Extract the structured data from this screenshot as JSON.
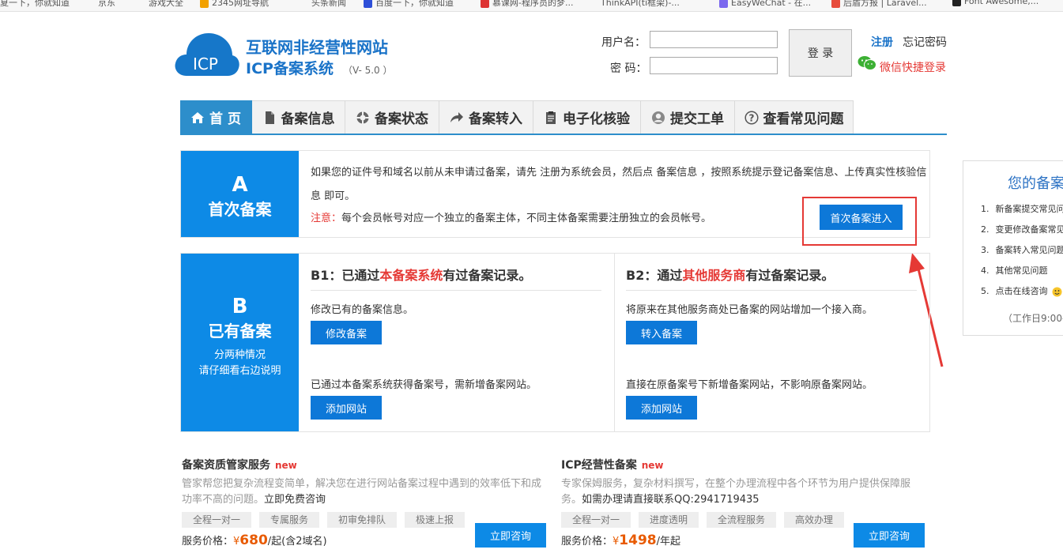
{
  "bookmarks": [
    "夏一下，你就知道",
    "京东",
    "游戏大全",
    "2345网址导航",
    "头条新闻",
    "百度一下，你就知道",
    "慕课网-程序员的梦...",
    "ThinkAPI(ti框架)-...",
    "EasyWeChat - 在...",
    "后盾方报 | Laravel...",
    "Font Awesome,..."
  ],
  "header": {
    "title_line1": "互联网非经营性网站",
    "title_line2": "ICP备案系统",
    "version": "（V- 5.0 ）",
    "logo_text": "ICP",
    "username_label": "用户名：",
    "password_label": "密  码：",
    "login_button": "登 录",
    "register_link": "注册",
    "forgot_link": "忘记密码",
    "wechat_login": "微信快捷登录"
  },
  "nav": [
    "首 页",
    "备案信息",
    "备案状态",
    "备案转入",
    "电子化核验",
    "提交工单",
    "查看常见问题"
  ],
  "sectionA": {
    "letter": "A",
    "title": "首次备案",
    "desc": "如果您的证件号和域名以前从未申请过备案，请先 注册为系统会员，然后点 备案信息 ，按照系统提示登记备案信息、上传真实性核验信息 即可。",
    "note_label": "注意：",
    "note_text": "每个会员帐号对应一个独立的备案主体，不同主体备案需要注册独立的会员帐号。",
    "button": "首次备案进入"
  },
  "sectionB": {
    "letter": "B",
    "title": "已有备案",
    "sub1": "分两种情况",
    "sub2": "请仔细看右边说明",
    "b1": {
      "head_pre": "B1：已通过",
      "head_red": "本备案系统",
      "head_post": "有过备案记录。",
      "text1": "修改已有的备案信息。",
      "btn1": "修改备案",
      "text2": "已通过本备案系统获得备案号，需新增备案网站。",
      "btn2": "添加网站"
    },
    "b2": {
      "head_pre": "B2：通过",
      "head_red": "其他服务商",
      "head_post": "有过备案记录。",
      "text1": "将原来在其他服务商处已备案的网站增加一个接入商。",
      "btn1": "转入备案",
      "text2": "直接在原备案号下新增备案网站，不影响原备案网站。",
      "btn2": "添加网站"
    }
  },
  "side": {
    "title": "您的备案",
    "items": [
      {
        "num": "1.",
        "text": "新备案提交常见问"
      },
      {
        "num": "2.",
        "text": "变更修改备案常见"
      },
      {
        "num": "3.",
        "text": "备案转入常见问题"
      },
      {
        "num": "4.",
        "text": "其他常见问题"
      },
      {
        "num": "5.",
        "text": "点击在线咨询"
      }
    ],
    "footer": "（工作日9:00-"
  },
  "services": [
    {
      "title": "备案资质管家服务",
      "new": "new",
      "desc_gray": "管家帮您把复杂流程变简单，解决您在进行网站备案过程中遇到的效率低下和成功率不高的问题。",
      "desc_dark": "立即免费咨询",
      "tags": [
        "全程一对一",
        "专属服务",
        "初审免排队",
        "极速上报"
      ],
      "price_label": "服务价格：",
      "price_yen": "¥",
      "price_amount": "680",
      "price_unit": "/起(含2域名)",
      "button": "立即咨询"
    },
    {
      "title": "ICP经营性备案",
      "new": "new",
      "desc_gray": "专家保姆服务，复杂材料撰写，在整个办理流程中各个环节为用户提供保障服务。",
      "desc_dark": "如需办理请直接联系QQ:2941719435",
      "tags": [
        "全程一对一",
        "进度透明",
        "全流程服务",
        "高效办理"
      ],
      "price_label": "服务价格：",
      "price_yen": "¥",
      "price_amount": "1498",
      "price_unit": "/年起",
      "button": "立即咨询"
    }
  ]
}
